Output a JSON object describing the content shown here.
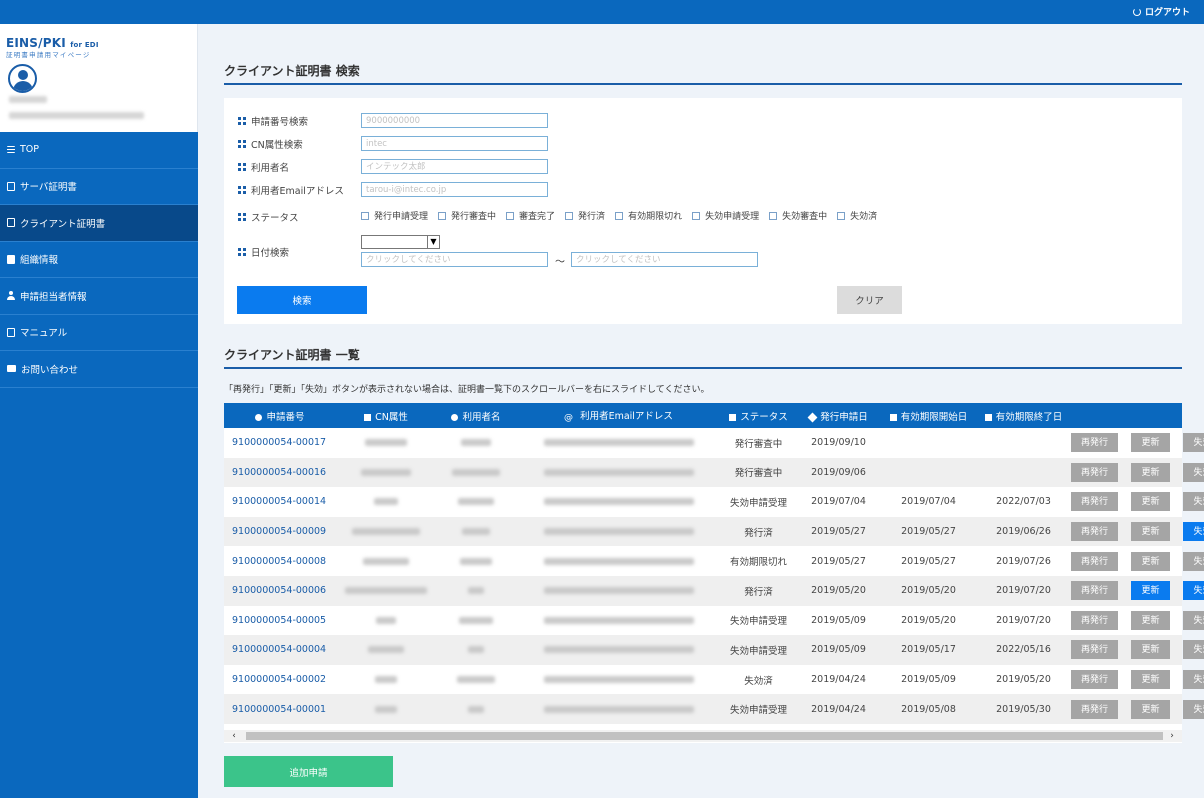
{
  "header": {
    "logout_label": "ログアウト",
    "logout_icon": "logout-icon"
  },
  "sidebar": {
    "logo": "EINS/PKI",
    "logo_suffix": "for EDI",
    "logo_sub": "証明書申請用マイページ",
    "items": [
      {
        "label": "TOP",
        "icon": "menu-icon"
      },
      {
        "label": "サーバ証明書",
        "icon": "document-icon"
      },
      {
        "label": "クライアント証明書",
        "icon": "document-icon",
        "active": true
      },
      {
        "label": "組織情報",
        "icon": "building-icon"
      },
      {
        "label": "申請担当者情報",
        "icon": "person-icon"
      },
      {
        "label": "マニュアル",
        "icon": "manual-icon"
      },
      {
        "label": "お問い合わせ",
        "icon": "mail-icon"
      }
    ]
  },
  "search": {
    "title": "クライアント証明書 検索",
    "labels": {
      "request_no": "申請番号検索",
      "cn": "CN属性検索",
      "user": "利用者名",
      "email": "利用者Emailアドレス",
      "status": "ステータス",
      "date": "日付検索"
    },
    "placeholders": {
      "request_no": "9000000000",
      "cn": "intec",
      "user": "インテック太郎",
      "email": "tarou-i@intec.co.jp",
      "date_from": "クリックしてください",
      "date_to": "クリックしてください"
    },
    "statuses": [
      "発行申請受理",
      "発行審査中",
      "審査完了",
      "発行済",
      "有効期限切れ",
      "失効申請受理",
      "失効審査中",
      "失効済"
    ],
    "tilde": "～",
    "search_button": "検索",
    "clear_button": "クリア"
  },
  "list": {
    "title": "クライアント証明書 一覧",
    "notice": "「再発行」「更新」「失効」ボタンが表示されない場合は、証明書一覧下のスクロールバーを右にスライドしてください。",
    "columns": [
      "申請番号",
      "CN属性",
      "利用者名",
      "利用者Emailアドレス",
      "ステータス",
      "発行申請日",
      "有効期限開始日",
      "有効期限終了日"
    ],
    "at_symbol": "@",
    "buttons": {
      "reissue": "再発行",
      "renew": "更新",
      "revoke": "失効"
    },
    "rows": [
      {
        "id": "9100000054-00017",
        "status": "発行審査中",
        "applied": "2019/09/10",
        "start": "",
        "end": "",
        "renew_active": false,
        "revoke_active": false
      },
      {
        "id": "9100000054-00016",
        "status": "発行審査中",
        "applied": "2019/09/06",
        "start": "",
        "end": "",
        "renew_active": false,
        "revoke_active": false
      },
      {
        "id": "9100000054-00014",
        "status": "失効申請受理",
        "applied": "2019/07/04",
        "start": "2019/07/04",
        "end": "2022/07/03",
        "renew_active": false,
        "revoke_active": false
      },
      {
        "id": "9100000054-00009",
        "status": "発行済",
        "applied": "2019/05/27",
        "start": "2019/05/27",
        "end": "2019/06/26",
        "renew_active": false,
        "revoke_active": true
      },
      {
        "id": "9100000054-00008",
        "status": "有効期限切れ",
        "applied": "2019/05/27",
        "start": "2019/05/27",
        "end": "2019/07/26",
        "renew_active": false,
        "revoke_active": false
      },
      {
        "id": "9100000054-00006",
        "status": "発行済",
        "applied": "2019/05/20",
        "start": "2019/05/20",
        "end": "2019/07/20",
        "renew_active": true,
        "revoke_active": true
      },
      {
        "id": "9100000054-00005",
        "status": "失効申請受理",
        "applied": "2019/05/09",
        "start": "2019/05/20",
        "end": "2019/07/20",
        "renew_active": false,
        "revoke_active": false
      },
      {
        "id": "9100000054-00004",
        "status": "失効申請受理",
        "applied": "2019/05/09",
        "start": "2019/05/17",
        "end": "2022/05/16",
        "renew_active": false,
        "revoke_active": false
      },
      {
        "id": "9100000054-00002",
        "status": "失効済",
        "applied": "2019/04/24",
        "start": "2019/05/09",
        "end": "2019/05/20",
        "renew_active": false,
        "revoke_active": false
      },
      {
        "id": "9100000054-00001",
        "status": "失効申請受理",
        "applied": "2019/04/24",
        "start": "2019/05/08",
        "end": "2019/05/30",
        "renew_active": false,
        "revoke_active": false
      }
    ]
  },
  "scroll": {
    "left_arrow": "‹",
    "right_arrow": "›"
  },
  "add_button": "追加申請",
  "colors": {
    "primary": "#0a68be",
    "active_nav": "#08498a",
    "button_blue": "#0a7bef",
    "button_gray": "#a5a5a5",
    "add_green": "#3bc48a"
  }
}
